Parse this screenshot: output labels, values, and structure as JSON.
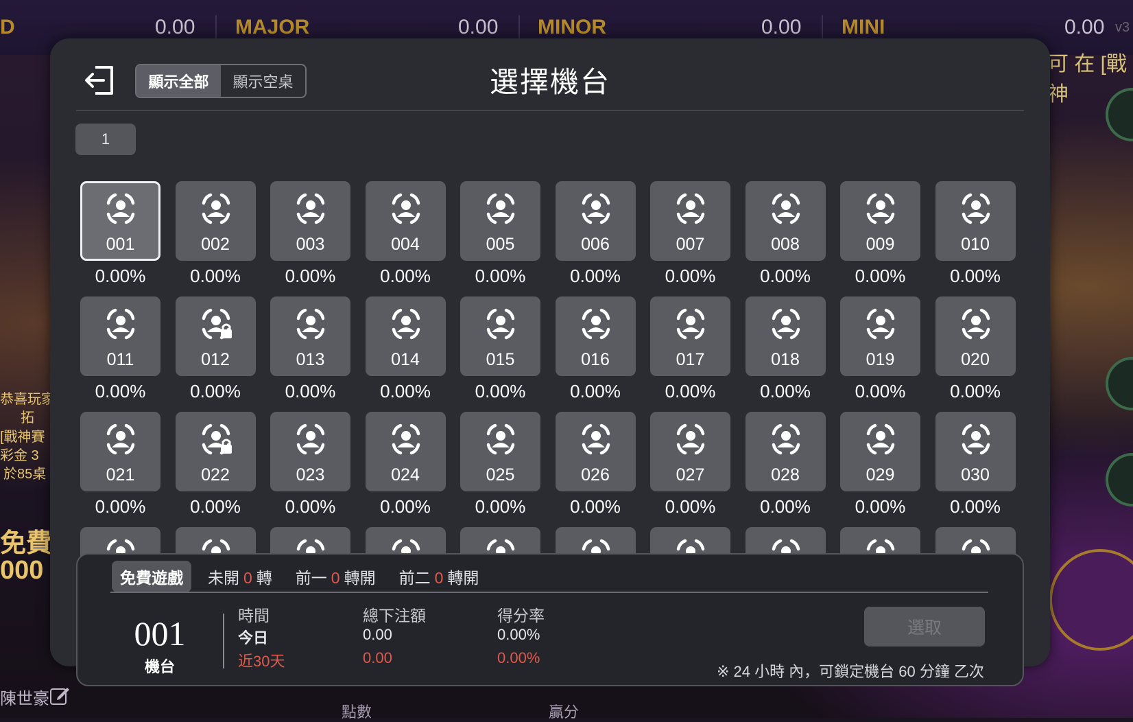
{
  "jackpots": [
    {
      "label": "D",
      "value": "0.00"
    },
    {
      "label": "MAJOR",
      "value": "0.00"
    },
    {
      "label": "MINOR",
      "value": "0.00"
    },
    {
      "label": "MINI",
      "value": "0.00"
    }
  ],
  "version_text": "v3",
  "background_texts": {
    "top_right": "可 在 [戰神",
    "left_1": "恭喜玩家",
    "left_2": "拓",
    "left_3": "[戰神賽",
    "left_4": "彩金 3",
    "left_5": "於85桌",
    "left_free": "免費",
    "left_free_amount": "000",
    "bottom_left_name": "陳世豪",
    "hud_points_label": "點數",
    "hud_win_label": "贏分"
  },
  "modal": {
    "title": "選擇機台",
    "filter_all": "顯示全部",
    "filter_empty": "顯示空桌",
    "page_number": "1"
  },
  "machines": [
    {
      "id": "001",
      "rate": "0.00%",
      "locked": false,
      "selected": true
    },
    {
      "id": "002",
      "rate": "0.00%",
      "locked": false,
      "selected": false
    },
    {
      "id": "003",
      "rate": "0.00%",
      "locked": false,
      "selected": false
    },
    {
      "id": "004",
      "rate": "0.00%",
      "locked": false,
      "selected": false
    },
    {
      "id": "005",
      "rate": "0.00%",
      "locked": false,
      "selected": false
    },
    {
      "id": "006",
      "rate": "0.00%",
      "locked": false,
      "selected": false
    },
    {
      "id": "007",
      "rate": "0.00%",
      "locked": false,
      "selected": false
    },
    {
      "id": "008",
      "rate": "0.00%",
      "locked": false,
      "selected": false
    },
    {
      "id": "009",
      "rate": "0.00%",
      "locked": false,
      "selected": false
    },
    {
      "id": "010",
      "rate": "0.00%",
      "locked": false,
      "selected": false
    },
    {
      "id": "011",
      "rate": "0.00%",
      "locked": false,
      "selected": false
    },
    {
      "id": "012",
      "rate": "0.00%",
      "locked": true,
      "selected": false
    },
    {
      "id": "013",
      "rate": "0.00%",
      "locked": false,
      "selected": false
    },
    {
      "id": "014",
      "rate": "0.00%",
      "locked": false,
      "selected": false
    },
    {
      "id": "015",
      "rate": "0.00%",
      "locked": false,
      "selected": false
    },
    {
      "id": "016",
      "rate": "0.00%",
      "locked": false,
      "selected": false
    },
    {
      "id": "017",
      "rate": "0.00%",
      "locked": false,
      "selected": false
    },
    {
      "id": "018",
      "rate": "0.00%",
      "locked": false,
      "selected": false
    },
    {
      "id": "019",
      "rate": "0.00%",
      "locked": false,
      "selected": false
    },
    {
      "id": "020",
      "rate": "0.00%",
      "locked": false,
      "selected": false
    },
    {
      "id": "021",
      "rate": "0.00%",
      "locked": false,
      "selected": false
    },
    {
      "id": "022",
      "rate": "0.00%",
      "locked": true,
      "selected": false
    },
    {
      "id": "023",
      "rate": "0.00%",
      "locked": false,
      "selected": false
    },
    {
      "id": "024",
      "rate": "0.00%",
      "locked": false,
      "selected": false
    },
    {
      "id": "025",
      "rate": "0.00%",
      "locked": false,
      "selected": false
    },
    {
      "id": "026",
      "rate": "0.00%",
      "locked": false,
      "selected": false
    },
    {
      "id": "027",
      "rate": "0.00%",
      "locked": false,
      "selected": false
    },
    {
      "id": "028",
      "rate": "0.00%",
      "locked": false,
      "selected": false
    },
    {
      "id": "029",
      "rate": "0.00%",
      "locked": false,
      "selected": false
    },
    {
      "id": "030",
      "rate": "0.00%",
      "locked": false,
      "selected": false
    }
  ],
  "details": {
    "tab_free": "免費遊戲",
    "tab_not_opened_prefix": "未開",
    "tab_not_opened_count": "0",
    "tab_not_opened_suffix": "轉",
    "tab_prev1_prefix": "前一",
    "tab_prev1_count": "0",
    "tab_prev1_suffix": "轉開",
    "tab_prev2_prefix": "前二",
    "tab_prev2_count": "0",
    "tab_prev2_suffix": "轉開",
    "machine_number": "001",
    "machine_label": "機台",
    "col_time": "時間",
    "col_bet": "總下注額",
    "col_rate": "得分率",
    "row_today": "今日",
    "today_bet": "0.00",
    "today_rate": "0.00%",
    "row_30d": "近30天",
    "d30_bet": "0.00",
    "d30_rate": "0.00%",
    "select_button": "選取",
    "note": "※ 24 小時 內，可鎖定機台 60 分鐘 乙次"
  },
  "colors": {
    "highlight_red": "#e2584a",
    "jackpot_gold": "#b58a2a",
    "modal_bg": "#2b2c32",
    "tile_bg": "#5b5c62"
  }
}
